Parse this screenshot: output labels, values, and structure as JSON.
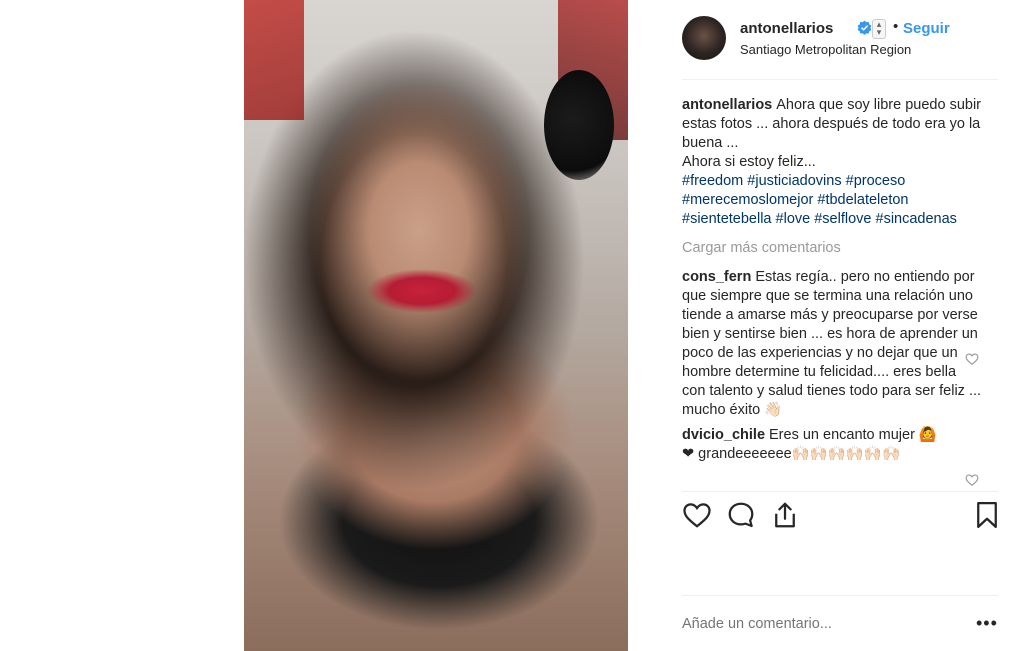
{
  "post": {
    "username": "antonellarios",
    "follow_label": "Seguir",
    "separator": "•",
    "location": "Santiago Metropolitan Region"
  },
  "caption": {
    "author": "antonellarios",
    "text": "Ahora que soy libre puedo subir estas fotos ... ahora después de todo era yo la buena ...",
    "line2": "Ahora si estoy feliz...",
    "hashtags": [
      "#freedom",
      "#justiciadovins",
      "#proceso",
      "#merecemoslomejor",
      "#tbdelateleton",
      "#sientetebella",
      "#love",
      "#selflove",
      "#sincadenas"
    ]
  },
  "load_more_label": "Cargar más comentarios",
  "comments": [
    {
      "author": "cons_fern",
      "text": "Estas regía.. pero no entiendo por que siempre que se termina una relación uno tiende a amarse más y preocuparse por verse bien y sentirse bien ... es hora de aprender un poco de las experiencias y no dejar que un hombre determine tu felicidad.... eres bella con talento y salud tienes todo para ser feliz ... mucho éxito 👋🏻"
    },
    {
      "author": "dvicio_chile",
      "text": "Eres un encanto mujer 🙆",
      "line2": "❤ grandeeeeeee🙌🏻🙌🏻🙌🏻🙌🏻🙌🏻🙌🏻"
    }
  ],
  "add_comment_placeholder": "Añade un comentario...",
  "more_label": "•••",
  "colors": {
    "link_blue": "#3897f0",
    "hashtag": "#003569",
    "muted": "#999999",
    "text": "#262626"
  },
  "icons": [
    "verified-badge-icon",
    "heart-icon",
    "comment-icon",
    "share-icon",
    "bookmark-icon",
    "small-heart-icon"
  ]
}
